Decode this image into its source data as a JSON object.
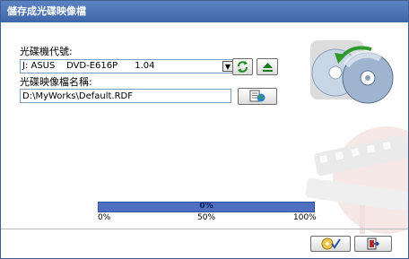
{
  "window": {
    "title": "儲存成光碟映像檔",
    "title_bar_color": "#4f74b5"
  },
  "drive": {
    "label": "光碟機代號:",
    "selected": "J: ASUS    DVD-E616P      1.04"
  },
  "image_file": {
    "label": "光碟映像檔名稱:",
    "value": "D:\\MyWorks\\Default.RDF"
  },
  "progress": {
    "fraction": 0.0,
    "text": "0%",
    "ticks": [
      "0%",
      "50%",
      "100%"
    ]
  },
  "icons": {
    "refresh": "refresh-icon",
    "eject": "eject-icon",
    "browse": "browse-folder-icon",
    "start": "disc-check-icon",
    "exit": "exit-icon",
    "disc_art": "disc-copy-icon"
  }
}
